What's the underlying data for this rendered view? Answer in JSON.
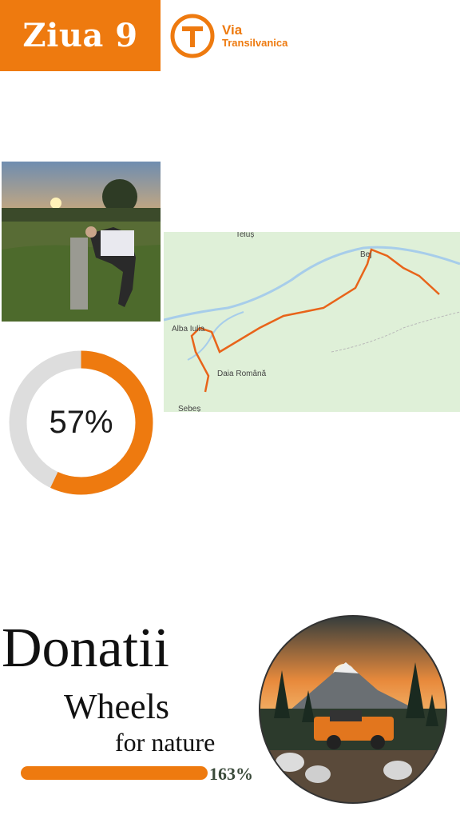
{
  "header": {
    "day_label": "Ziua 9",
    "brand_line1": "Via",
    "brand_line2": "Transilvanica",
    "brand_logo_letter": "T"
  },
  "map": {
    "places": [
      "Teluș",
      "Bej",
      "Alba Iulia",
      "Daia Română",
      "Sebeș"
    ]
  },
  "progress": {
    "value": 0.57,
    "label": "57%"
  },
  "donations": {
    "title": "Donatii",
    "subtitle_line1": "Wheels",
    "subtitle_line2": "for nature",
    "percent_label": "163%",
    "percent_value": 1.63
  },
  "colors": {
    "accent": "#ee7a0f",
    "track": "#dddddd",
    "map_bg": "#dff0d8",
    "route": "#e8641a"
  }
}
